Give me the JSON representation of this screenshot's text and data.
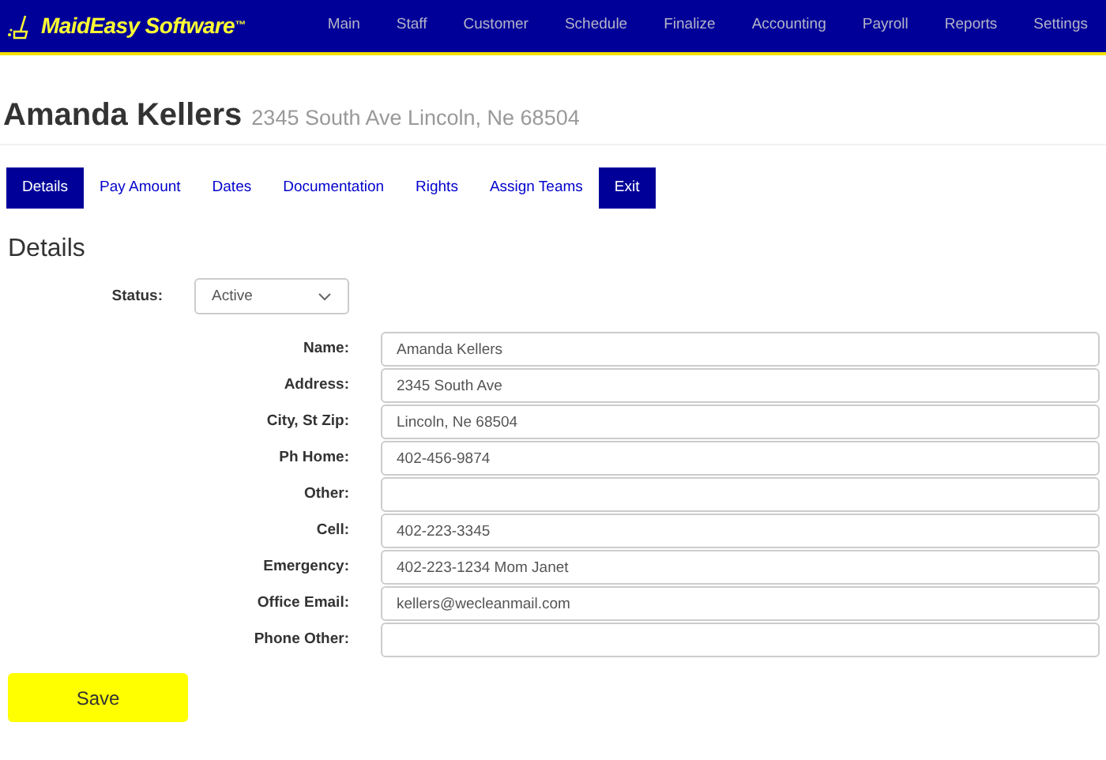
{
  "brand": {
    "name": "MaidEasy Software",
    "mark": "™"
  },
  "nav": [
    "Main",
    "Staff",
    "Customer",
    "Schedule",
    "Finalize",
    "Accounting",
    "Payroll",
    "Reports",
    "Settings"
  ],
  "header": {
    "name": "Amanda Kellers",
    "address": "2345 South Ave Lincoln, Ne 68504"
  },
  "tabs": [
    {
      "label": "Details",
      "kind": "tab",
      "selected": true
    },
    {
      "label": "Pay Amount",
      "kind": "tab",
      "selected": false
    },
    {
      "label": "Dates",
      "kind": "tab",
      "selected": false
    },
    {
      "label": "Documentation",
      "kind": "tab",
      "selected": false
    },
    {
      "label": "Rights",
      "kind": "tab",
      "selected": false
    },
    {
      "label": "Assign Teams",
      "kind": "tab",
      "selected": false
    },
    {
      "label": "Exit",
      "kind": "button"
    }
  ],
  "section_title": "Details",
  "status": {
    "label": "Status:",
    "value": "Active"
  },
  "fields": [
    {
      "label": "Name:",
      "value": "Amanda Kellers"
    },
    {
      "label": "Address:",
      "value": "2345 South Ave"
    },
    {
      "label": "City, St Zip:",
      "value": "Lincoln, Ne 68504"
    },
    {
      "label": "Ph Home:",
      "value": "402-456-9874"
    },
    {
      "label": "Other:"
    },
    {
      "label": "Cell:",
      "value": "402-223-3345"
    },
    {
      "label": "Emergency:",
      "value": "402-223-1234 Mom Janet"
    },
    {
      "label": "Office Email:",
      "value": "kellers@wecleanmail.com"
    },
    {
      "label": "Phone Other:"
    }
  ],
  "save_button": "Save"
}
